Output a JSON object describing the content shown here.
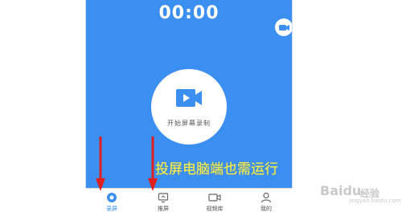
{
  "screen": {
    "timer": "00:00",
    "record_button_label": "开始屏幕录制",
    "overlay_caption": "投屏电脑端也需运行"
  },
  "bottom_nav": {
    "items": [
      {
        "label": "录屏",
        "icon": "record-dot-icon",
        "active": true
      },
      {
        "label": "推屏",
        "icon": "screen-cast-icon",
        "active": false
      },
      {
        "label": "视频库",
        "icon": "video-camera-icon",
        "active": false
      },
      {
        "label": "我的",
        "icon": "user-icon",
        "active": false
      }
    ]
  },
  "watermark": {
    "brand": "Baidu",
    "sub": "经验",
    "url": "jingyan.baidu.com"
  },
  "colors": {
    "screen_blue": "#3a8ff0",
    "caption_yellow": "#f6f25a",
    "annotation_red": "#e02020"
  }
}
